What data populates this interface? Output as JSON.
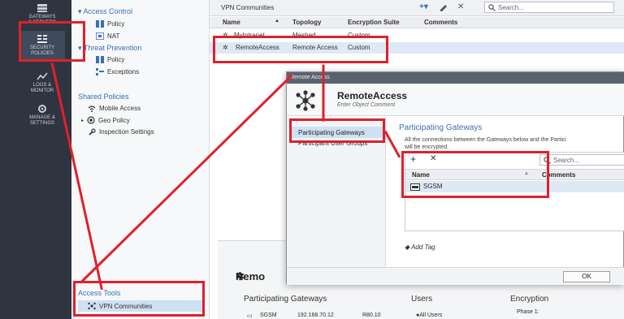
{
  "rail": {
    "items": [
      {
        "label_1": "GATEWAYS",
        "label_2": "& SERVERS"
      },
      {
        "label_1": "SECURITY",
        "label_2": "POLICIES"
      },
      {
        "label_1": "LOGS &",
        "label_2": "MONITOR"
      },
      {
        "label_1": "MANAGE &",
        "label_2": "SETTINGS"
      }
    ]
  },
  "tree": {
    "access_control": "Access Control",
    "ac_policy": "Policy",
    "ac_nat": "NAT",
    "threat_prevention": "Threat Prevention",
    "tp_policy": "Policy",
    "tp_exceptions": "Exceptions",
    "shared_policies": "Shared Policies",
    "mobile_access": "Mobile Access",
    "geo_policy": "Geo Policy",
    "inspection_settings": "Inspection Settings",
    "access_tools": "Access Tools",
    "vpn_communities": "VPN Communities"
  },
  "main": {
    "title": "VPN Communities",
    "search_placeholder": "Search...",
    "columns": {
      "name": "Name",
      "topology": "Topology",
      "encryption": "Encryption Suite",
      "comments": "Comments"
    },
    "rows": [
      {
        "name": "MyIntranet",
        "topology": "Meshed",
        "encryption": "Custom"
      },
      {
        "name": "RemoteAccess",
        "topology": "Remote Access",
        "encryption": "Custom"
      }
    ]
  },
  "summary": {
    "title": "Remo",
    "participating_gateways": "Participating Gateways",
    "users": "Users",
    "encryption": "Encryption",
    "gw_name": "SGSM",
    "gw_ip": "192.168.70.12",
    "gw_extra": "R80.10",
    "users_value": "All Users",
    "phase": "Phase 1:"
  },
  "dialog": {
    "window_title": "Remote Access",
    "object_name": "RemoteAccess",
    "comment_placeholder": "Enter Object Comment",
    "nav": {
      "participating_gateways": "Participating Gateways",
      "participant_user_groups": "Participant User Groups"
    },
    "section_title": "Participating Gateways",
    "description_1": "All the connections between the Gateways below and the Partici",
    "description_2": "will be encrypted.",
    "search_placeholder": "Search...",
    "grid": {
      "name_col": "Name",
      "comments_col": "Comments",
      "rows": [
        {
          "name": "SGSM"
        }
      ]
    },
    "add_tag": "Add Tag",
    "ok": "OK"
  },
  "colors": {
    "annotation_red": "#e0202a",
    "selection_blue": "#cfe0f2",
    "link_blue": "#3a6fb0"
  }
}
